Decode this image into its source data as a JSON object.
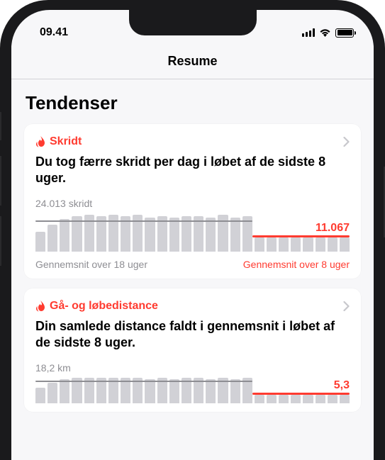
{
  "status": {
    "time": "09.41"
  },
  "nav": {
    "title": "Resume"
  },
  "section": {
    "title": "Tendenser"
  },
  "card1": {
    "label": "Skridt",
    "description": "Du tog færre skridt per dag i løbet af de sidste 8 uger.",
    "avg_old_label": "24.013 skridt",
    "avg_new_value": "11.067",
    "footer_left": "Gennemsnit over 18 uger",
    "footer_right": "Gennemsnit over 8 uger"
  },
  "card2": {
    "label": "Gå- og løbedistance",
    "description": "Din samlede distance faldt i gennemsnit i løbet af de sidste 8 uger.",
    "avg_old_label": "18,2 km",
    "avg_new_value": "5,3"
  },
  "chart_data": [
    {
      "type": "bar",
      "title": "Skridt",
      "categories_desc": "26 weekly bars",
      "values": [
        20,
        28,
        35,
        38,
        40,
        38,
        40,
        38,
        40,
        36,
        38,
        36,
        38,
        38,
        36,
        40,
        36,
        38,
        14,
        14,
        14,
        14,
        14,
        14,
        14,
        14
      ],
      "avg_18w": 24013,
      "avg_8w": 11067,
      "unit": "skridt",
      "xlabel": "",
      "ylabel": "",
      "ylim": [
        0,
        42
      ]
    },
    {
      "type": "bar",
      "title": "Gå- og løbedistance",
      "categories_desc": "26 weekly bars (partially visible)",
      "values": [
        18,
        24,
        28,
        30,
        30,
        30,
        30,
        30,
        30,
        28,
        30,
        28,
        30,
        30,
        28,
        30,
        28,
        30,
        10,
        10,
        10,
        10,
        10,
        10,
        10,
        10
      ],
      "avg_18w": 18.2,
      "avg_8w": 5.3,
      "unit": "km",
      "xlabel": "",
      "ylabel": "",
      "ylim": [
        0,
        32
      ]
    }
  ]
}
